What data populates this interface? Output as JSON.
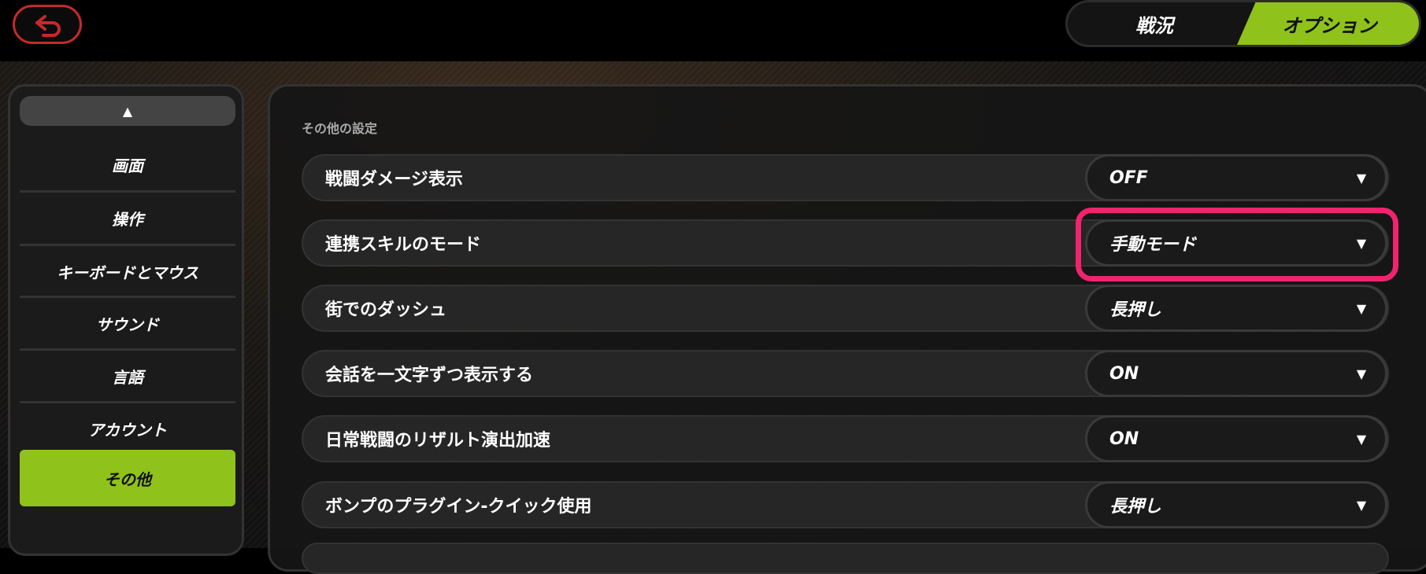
{
  "header": {
    "tabs": [
      {
        "label": "戦況",
        "active": false
      },
      {
        "label": "オプション",
        "active": true
      }
    ],
    "back_icon": "return-icon",
    "colors": {
      "accent": "#8fc21a",
      "back": "#c42a2a",
      "highlight": "#f0236e"
    }
  },
  "sidebar": {
    "up_icon": "▲",
    "items": [
      {
        "label": "画面",
        "active": false
      },
      {
        "label": "操作",
        "active": false
      },
      {
        "label": "キーボードとマウス",
        "active": false
      },
      {
        "label": "サウンド",
        "active": false
      },
      {
        "label": "言語",
        "active": false
      },
      {
        "label": "アカウント",
        "active": false
      },
      {
        "label": "その他",
        "active": true
      }
    ]
  },
  "main": {
    "section_title": "その他の設定",
    "settings": [
      {
        "label": "戦闘ダメージ表示",
        "value": "OFF"
      },
      {
        "label": "連携スキルのモード",
        "value": "手動モード",
        "highlighted": true
      },
      {
        "label": "街でのダッシュ",
        "value": "長押し"
      },
      {
        "label": "会話を一文字ずつ表示する",
        "value": "ON"
      },
      {
        "label": "日常戦闘のリザルト演出加速",
        "value": "ON"
      },
      {
        "label": "ボンプのプラグイン-クイック使用",
        "value": "長押し"
      }
    ],
    "dropdown_arrow": "▼"
  }
}
